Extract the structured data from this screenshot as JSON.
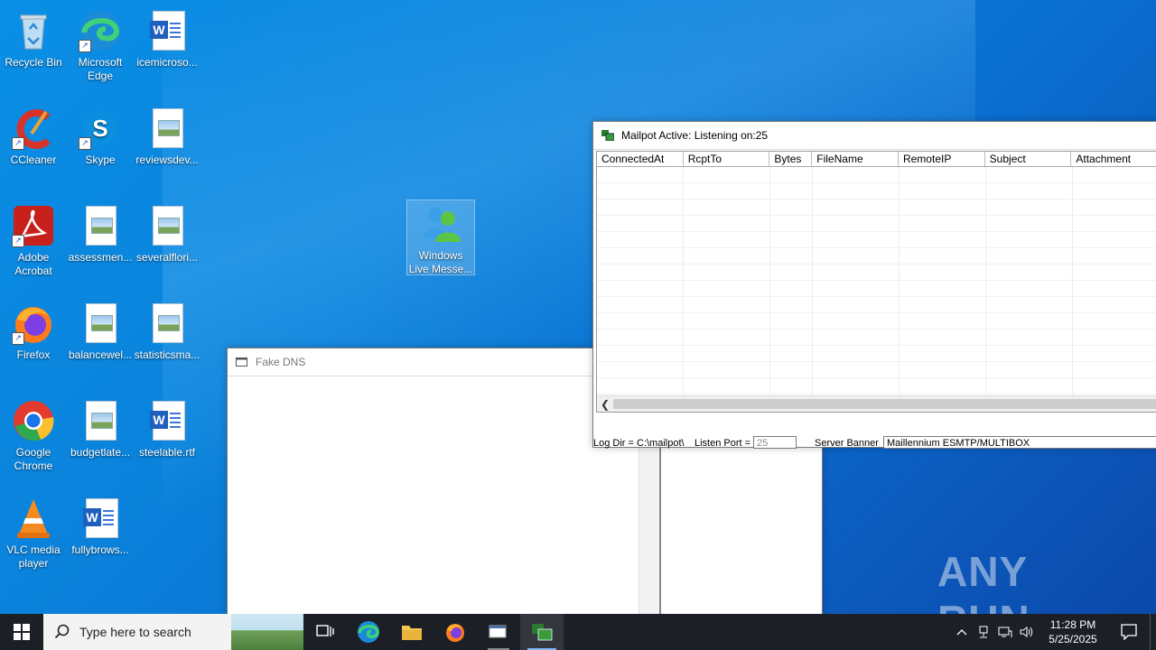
{
  "desktop": {
    "icons": [
      {
        "label": "Recycle Bin"
      },
      {
        "label": "Microsoft Edge"
      },
      {
        "label": "icemicroso..."
      },
      {
        "label": "CCleaner"
      },
      {
        "label": "Skype"
      },
      {
        "label": "reviewsdev..."
      },
      {
        "label": "Adobe Acrobat"
      },
      {
        "label": "assessmen..."
      },
      {
        "label": "severalflori..."
      },
      {
        "label": "Firefox"
      },
      {
        "label": "balancewel..."
      },
      {
        "label": "statisticsma..."
      },
      {
        "label": "Google Chrome"
      },
      {
        "label": "budgetlate..."
      },
      {
        "label": "steelable.rtf"
      },
      {
        "label": "VLC media player"
      },
      {
        "label": "fullybrows..."
      },
      {
        "label": "Windows Live Messe..."
      }
    ]
  },
  "fake_dns": {
    "title": "Fake DNS"
  },
  "mailpot": {
    "title": "Mailpot Active: Listening on:25",
    "columns": [
      "ConnectedAt",
      "RcptTo",
      "Bytes",
      "FileName",
      "RemoteIP",
      "Subject",
      "Attachment"
    ],
    "log_dir_label": "Log Dir = C:\\mailpot\\",
    "listen_port_label": "Listen Port =",
    "listen_port_value": "25",
    "server_banner_label": "Server Banner",
    "server_banner_value": "Maillennium ESMTP/MULTIBOX"
  },
  "taskbar": {
    "search_placeholder": "Type here to search",
    "time": "11:28 PM",
    "date": "5/25/2025"
  },
  "watermark": "ANY RUN",
  "colors": {
    "taskbar": "#1c1f26",
    "accent": "#0a82db"
  }
}
